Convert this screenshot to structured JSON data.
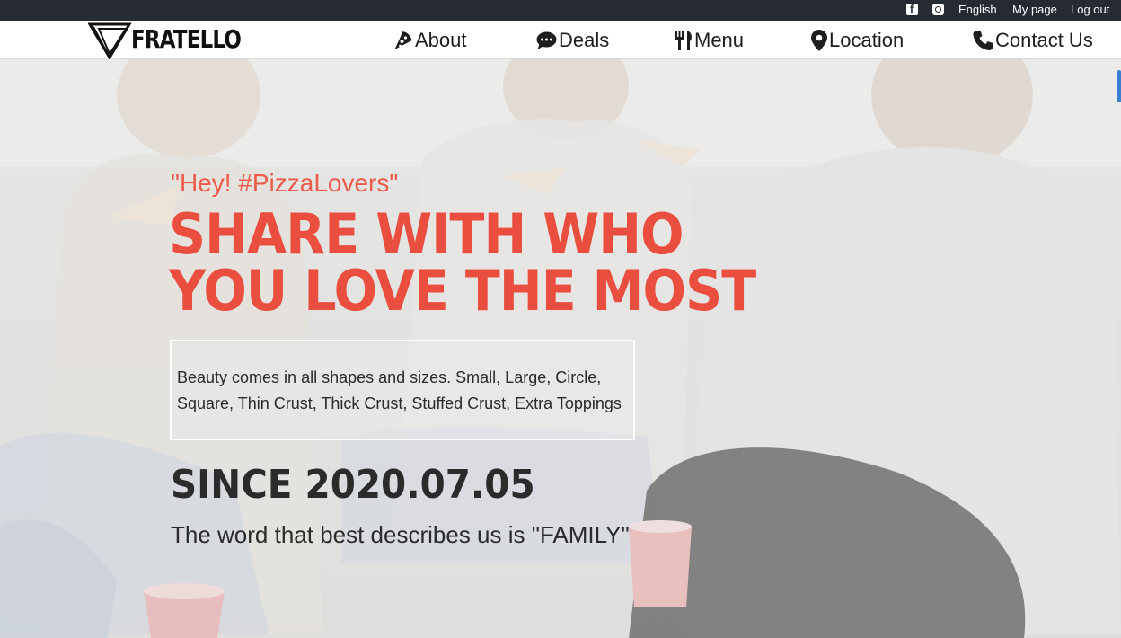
{
  "topbar": {
    "social": [
      "facebook-icon",
      "instagram-icon"
    ],
    "links": [
      "English",
      "My page",
      "Log out"
    ]
  },
  "brand": {
    "name": "FRATELLO"
  },
  "nav": [
    {
      "label": "About",
      "icon": "pizza-slice-icon"
    },
    {
      "label": "Deals",
      "icon": "chat-bubble-icon"
    },
    {
      "label": "Menu",
      "icon": "utensils-icon"
    },
    {
      "label": "Location",
      "icon": "map-pin-icon"
    },
    {
      "label": "Contact Us",
      "icon": "phone-icon"
    }
  ],
  "hero": {
    "quote": "\"Hey! #PizzaLovers\"",
    "headline_line1": "SHARE WITH WHO",
    "headline_line2": "YOU LOVE THE MOST",
    "description": "Beauty comes in all shapes and sizes. Small, Large, Circle, Square, Thin Crust, Thick Crust, Stuffed Crust, Extra Toppings",
    "since": "SINCE 2020.07.05",
    "tagline": "The word that best describes us is \"FAMILY\""
  },
  "colors": {
    "topbar_bg": "#262a33",
    "accent": "#ea4e3f",
    "text_dark": "#2b2b2b",
    "nav_bg": "#ffffff"
  }
}
